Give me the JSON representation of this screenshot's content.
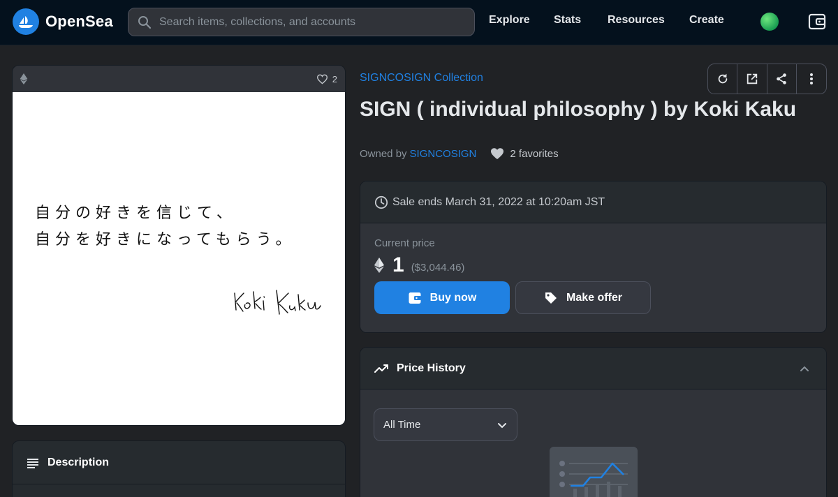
{
  "nav": {
    "brand": "OpenSea",
    "search_placeholder": "Search items, collections, and accounts",
    "links": [
      "Explore",
      "Stats",
      "Resources",
      "Create"
    ]
  },
  "item": {
    "chain_icon": "ethereum-icon",
    "favorites_count": "2",
    "collection": "SIGNCOSIGN Collection",
    "title": "SIGN ( individual philosophy ) by Koki Kaku",
    "owned_by_label": "Owned by",
    "owner": "SIGNCOSIGN",
    "favorites_label": "2 favorites",
    "artwork": {
      "line1": "自分の好きを信じて、",
      "line2": "自分を好きになってもらう。",
      "signature": "Koki Kaku"
    }
  },
  "sale": {
    "ends_text": "Sale ends March 31, 2022 at 10:20am JST",
    "price_label": "Current price",
    "price": "1",
    "price_usd": "($3,044.46)",
    "buy_label": "Buy now",
    "offer_label": "Make offer"
  },
  "price_history": {
    "title": "Price History",
    "period": "All Time"
  },
  "description": {
    "title": "Description"
  },
  "colors": {
    "accent": "#2081e2",
    "background": "#202225",
    "nav_background": "#04111d",
    "card": "#303339"
  }
}
